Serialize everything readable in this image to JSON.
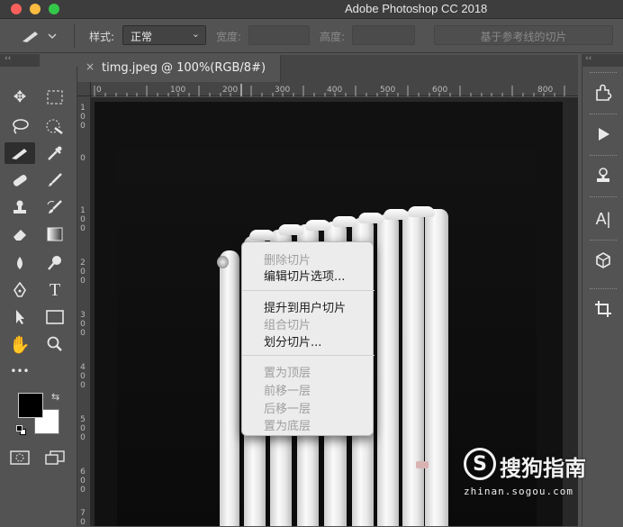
{
  "window": {
    "title": "Adobe Photoshop CC 2018"
  },
  "options_bar": {
    "style_label": "样式:",
    "style_value": "正常",
    "width_label": "宽度:",
    "height_label": "高度:",
    "guides_button": "基于参考线的切片"
  },
  "panel_collapse": "‹‹",
  "panel_collapse_right": "‹‹",
  "document": {
    "tab_title": "timg.jpeg @ 100%(RGB/8#)",
    "close_glyph": "×"
  },
  "ruler": {
    "h_labels": [
      "0",
      "100",
      "200",
      "300",
      "400",
      "500",
      "600",
      "800"
    ],
    "v_labels": [
      "1 0 0",
      "0",
      "1 0 0",
      "2 0 0",
      "3 0 0",
      "4 0 0",
      "5 0 0",
      "6 0 0",
      "7 0"
    ]
  },
  "tools": [
    "move-icon",
    "marquee-icon",
    "lasso-icon",
    "quick-select-icon",
    "slice-icon",
    "eyedropper-icon",
    "healing-icon",
    "brush-icon",
    "stamp-icon",
    "history-brush-icon",
    "eraser-icon",
    "gradient-icon",
    "blur-icon",
    "dodge-icon",
    "pen-icon",
    "type-icon",
    "path-select-icon",
    "shape-icon",
    "hand-icon",
    "zoom-icon"
  ],
  "tool_more": "•••",
  "context_menu": {
    "items": [
      {
        "label": "删除切片",
        "enabled": false
      },
      {
        "label": "编辑切片选项...",
        "enabled": true
      },
      {
        "label": "提升到用户切片",
        "enabled": true
      },
      {
        "label": "组合切片",
        "enabled": false
      },
      {
        "label": "划分切片...",
        "enabled": true
      },
      {
        "label": "置为顶层",
        "enabled": false
      },
      {
        "label": "前移一层",
        "enabled": false
      },
      {
        "label": "后移一层",
        "enabled": false
      },
      {
        "label": "置为底层",
        "enabled": false
      }
    ]
  },
  "right_dock": [
    "puzzle-icon",
    "play-icon",
    "stamp-panel-icon",
    "character-icon",
    "3d-icon",
    "crop-icon"
  ],
  "right_dock_char": "A|",
  "watermark": {
    "brand": "搜狗指南",
    "logo_letter": "S",
    "url": "zhinan.sogou.com"
  }
}
